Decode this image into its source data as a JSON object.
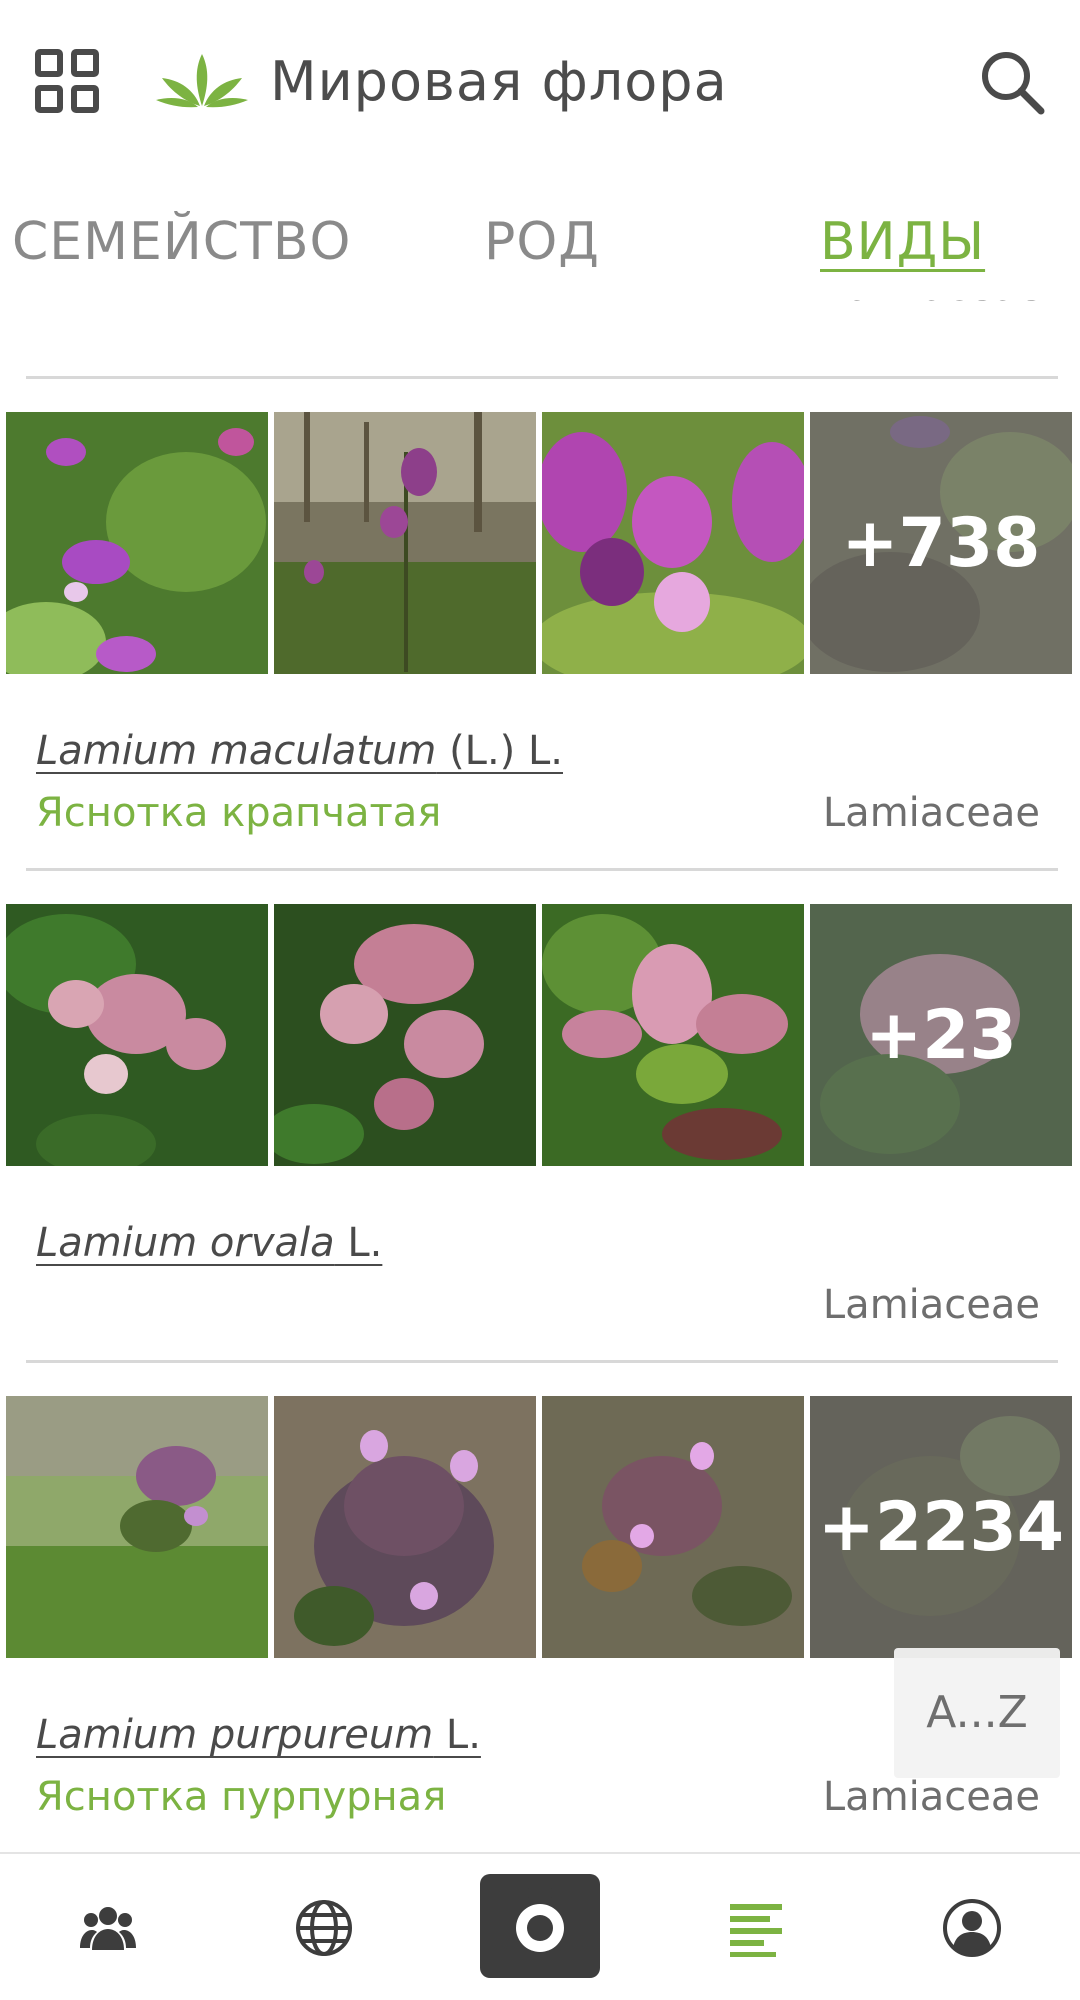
{
  "header": {
    "title": "Мировая флора",
    "menu_icon": "grid-icon",
    "logo_icon": "leaf-logo-icon",
    "search_icon": "search-icon",
    "accent_color": "#7cb342"
  },
  "tabs": [
    {
      "label": "СЕМЕЙСТВО",
      "active": false
    },
    {
      "label": "РОД",
      "active": false
    },
    {
      "label": "ВИДЫ",
      "active": true
    }
  ],
  "clipped_family": "Lamiaceae",
  "species": [
    {
      "genus_species": "Lamium maculatum",
      "author": " (L.) L.",
      "common_name": "Яснотка крапчатая",
      "family": "Lamiaceae",
      "more_count": "+738"
    },
    {
      "genus_species": "Lamium orvala",
      "author": " L.",
      "common_name": "",
      "family": "Lamiaceae",
      "more_count": "+23"
    },
    {
      "genus_species": "Lamium purpureum",
      "author": " L.",
      "common_name": "Яснотка пурпурная",
      "family": "Lamiaceae",
      "more_count": "+2234"
    }
  ],
  "az_button": {
    "label": "A...Z"
  },
  "bottom_nav": [
    {
      "icon": "community-icon",
      "active": false
    },
    {
      "icon": "globe-icon",
      "active": false
    },
    {
      "icon": "camera-icon",
      "active": false
    },
    {
      "icon": "list-icon",
      "active": true
    },
    {
      "icon": "profile-icon",
      "active": false
    }
  ]
}
